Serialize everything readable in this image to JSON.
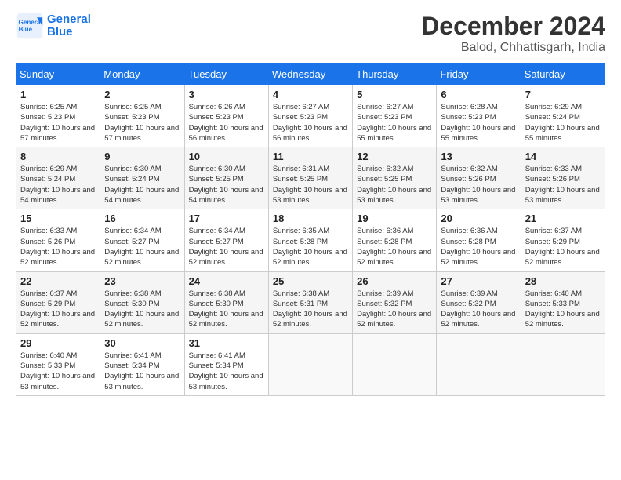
{
  "logo": {
    "line1": "General",
    "line2": "Blue"
  },
  "title": "December 2024",
  "location": "Balod, Chhattisgarh, India",
  "weekdays": [
    "Sunday",
    "Monday",
    "Tuesday",
    "Wednesday",
    "Thursday",
    "Friday",
    "Saturday"
  ],
  "weeks": [
    [
      {
        "day": "1",
        "sunrise": "6:25 AM",
        "sunset": "5:23 PM",
        "daylight": "10 hours and 57 minutes."
      },
      {
        "day": "2",
        "sunrise": "6:25 AM",
        "sunset": "5:23 PM",
        "daylight": "10 hours and 57 minutes."
      },
      {
        "day": "3",
        "sunrise": "6:26 AM",
        "sunset": "5:23 PM",
        "daylight": "10 hours and 56 minutes."
      },
      {
        "day": "4",
        "sunrise": "6:27 AM",
        "sunset": "5:23 PM",
        "daylight": "10 hours and 56 minutes."
      },
      {
        "day": "5",
        "sunrise": "6:27 AM",
        "sunset": "5:23 PM",
        "daylight": "10 hours and 55 minutes."
      },
      {
        "day": "6",
        "sunrise": "6:28 AM",
        "sunset": "5:23 PM",
        "daylight": "10 hours and 55 minutes."
      },
      {
        "day": "7",
        "sunrise": "6:29 AM",
        "sunset": "5:24 PM",
        "daylight": "10 hours and 55 minutes."
      }
    ],
    [
      {
        "day": "8",
        "sunrise": "6:29 AM",
        "sunset": "5:24 PM",
        "daylight": "10 hours and 54 minutes."
      },
      {
        "day": "9",
        "sunrise": "6:30 AM",
        "sunset": "5:24 PM",
        "daylight": "10 hours and 54 minutes."
      },
      {
        "day": "10",
        "sunrise": "6:30 AM",
        "sunset": "5:25 PM",
        "daylight": "10 hours and 54 minutes."
      },
      {
        "day": "11",
        "sunrise": "6:31 AM",
        "sunset": "5:25 PM",
        "daylight": "10 hours and 53 minutes."
      },
      {
        "day": "12",
        "sunrise": "6:32 AM",
        "sunset": "5:25 PM",
        "daylight": "10 hours and 53 minutes."
      },
      {
        "day": "13",
        "sunrise": "6:32 AM",
        "sunset": "5:26 PM",
        "daylight": "10 hours and 53 minutes."
      },
      {
        "day": "14",
        "sunrise": "6:33 AM",
        "sunset": "5:26 PM",
        "daylight": "10 hours and 53 minutes."
      }
    ],
    [
      {
        "day": "15",
        "sunrise": "6:33 AM",
        "sunset": "5:26 PM",
        "daylight": "10 hours and 52 minutes."
      },
      {
        "day": "16",
        "sunrise": "6:34 AM",
        "sunset": "5:27 PM",
        "daylight": "10 hours and 52 minutes."
      },
      {
        "day": "17",
        "sunrise": "6:34 AM",
        "sunset": "5:27 PM",
        "daylight": "10 hours and 52 minutes."
      },
      {
        "day": "18",
        "sunrise": "6:35 AM",
        "sunset": "5:28 PM",
        "daylight": "10 hours and 52 minutes."
      },
      {
        "day": "19",
        "sunrise": "6:36 AM",
        "sunset": "5:28 PM",
        "daylight": "10 hours and 52 minutes."
      },
      {
        "day": "20",
        "sunrise": "6:36 AM",
        "sunset": "5:28 PM",
        "daylight": "10 hours and 52 minutes."
      },
      {
        "day": "21",
        "sunrise": "6:37 AM",
        "sunset": "5:29 PM",
        "daylight": "10 hours and 52 minutes."
      }
    ],
    [
      {
        "day": "22",
        "sunrise": "6:37 AM",
        "sunset": "5:29 PM",
        "daylight": "10 hours and 52 minutes."
      },
      {
        "day": "23",
        "sunrise": "6:38 AM",
        "sunset": "5:30 PM",
        "daylight": "10 hours and 52 minutes."
      },
      {
        "day": "24",
        "sunrise": "6:38 AM",
        "sunset": "5:30 PM",
        "daylight": "10 hours and 52 minutes."
      },
      {
        "day": "25",
        "sunrise": "6:38 AM",
        "sunset": "5:31 PM",
        "daylight": "10 hours and 52 minutes."
      },
      {
        "day": "26",
        "sunrise": "6:39 AM",
        "sunset": "5:32 PM",
        "daylight": "10 hours and 52 minutes."
      },
      {
        "day": "27",
        "sunrise": "6:39 AM",
        "sunset": "5:32 PM",
        "daylight": "10 hours and 52 minutes."
      },
      {
        "day": "28",
        "sunrise": "6:40 AM",
        "sunset": "5:33 PM",
        "daylight": "10 hours and 52 minutes."
      }
    ],
    [
      {
        "day": "29",
        "sunrise": "6:40 AM",
        "sunset": "5:33 PM",
        "daylight": "10 hours and 53 minutes."
      },
      {
        "day": "30",
        "sunrise": "6:41 AM",
        "sunset": "5:34 PM",
        "daylight": "10 hours and 53 minutes."
      },
      {
        "day": "31",
        "sunrise": "6:41 AM",
        "sunset": "5:34 PM",
        "daylight": "10 hours and 53 minutes."
      },
      null,
      null,
      null,
      null
    ]
  ]
}
